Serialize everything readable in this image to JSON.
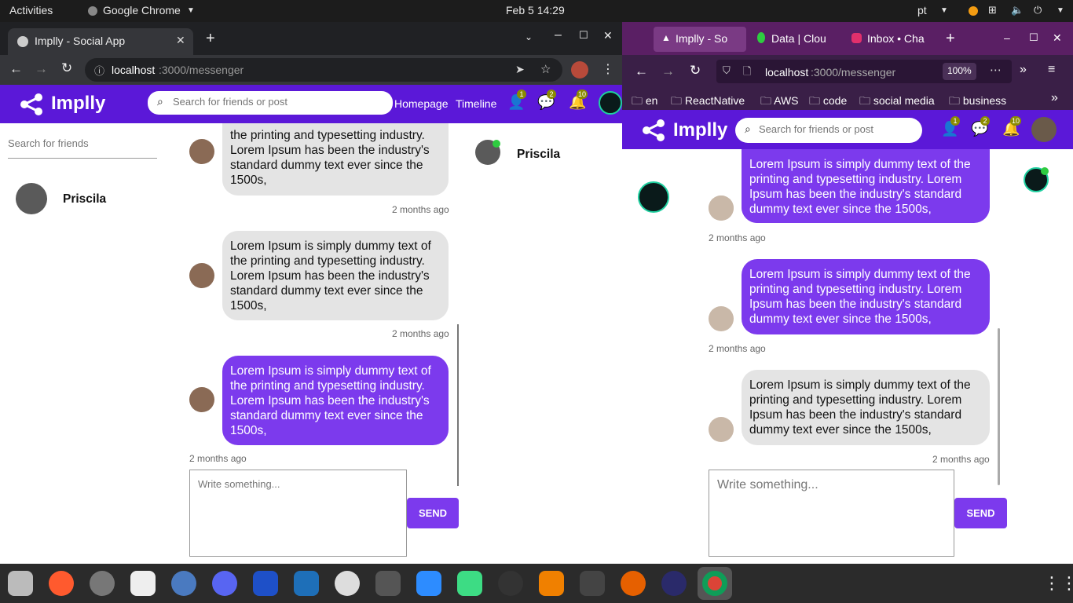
{
  "desktop": {
    "activities": "Activities",
    "app_name": "Google Chrome",
    "clock": "Feb 5  14:29",
    "lang": "pt"
  },
  "chrome": {
    "tab_title": "Implly - Social App",
    "url_host": "localhost",
    "url_path": ":3000/messenger"
  },
  "firefox": {
    "tabs": [
      "Implly - So",
      "Data | Clou",
      "Inbox • Cha"
    ],
    "url_host": "localhost",
    "url_path": ":3000/messenger",
    "zoom": "100%",
    "bookmarks": [
      "en",
      "ReactNative",
      "AWS",
      "code",
      "social media",
      "business"
    ]
  },
  "app": {
    "logo": "Implly",
    "search_placeholder": "Search for friends or post",
    "nav": [
      "Homepage",
      "Timeline"
    ],
    "badges": {
      "friends": "1",
      "messages": "2",
      "notifications": "10"
    },
    "friend_search_placeholder": "Search for friends",
    "contact_name": "Priscila",
    "online_name": "Priscila",
    "message_text": "Lorem Ipsum is simply dummy text of the printing and typesetting industry. Lorem Ipsum has been the industry's standard dummy text ever since the 1500s,",
    "message_text_cut": "the printing and typesetting industry. Lorem Ipsum has been the industry's standard dummy text ever since the 1500s,",
    "timestamp": "2 months ago",
    "composer_placeholder": "Write something...",
    "send_label": "SEND"
  },
  "colors": {
    "brand": "#5b18d8",
    "own_bubble": "#7c3aed",
    "other_bubble": "#e4e4e4"
  }
}
